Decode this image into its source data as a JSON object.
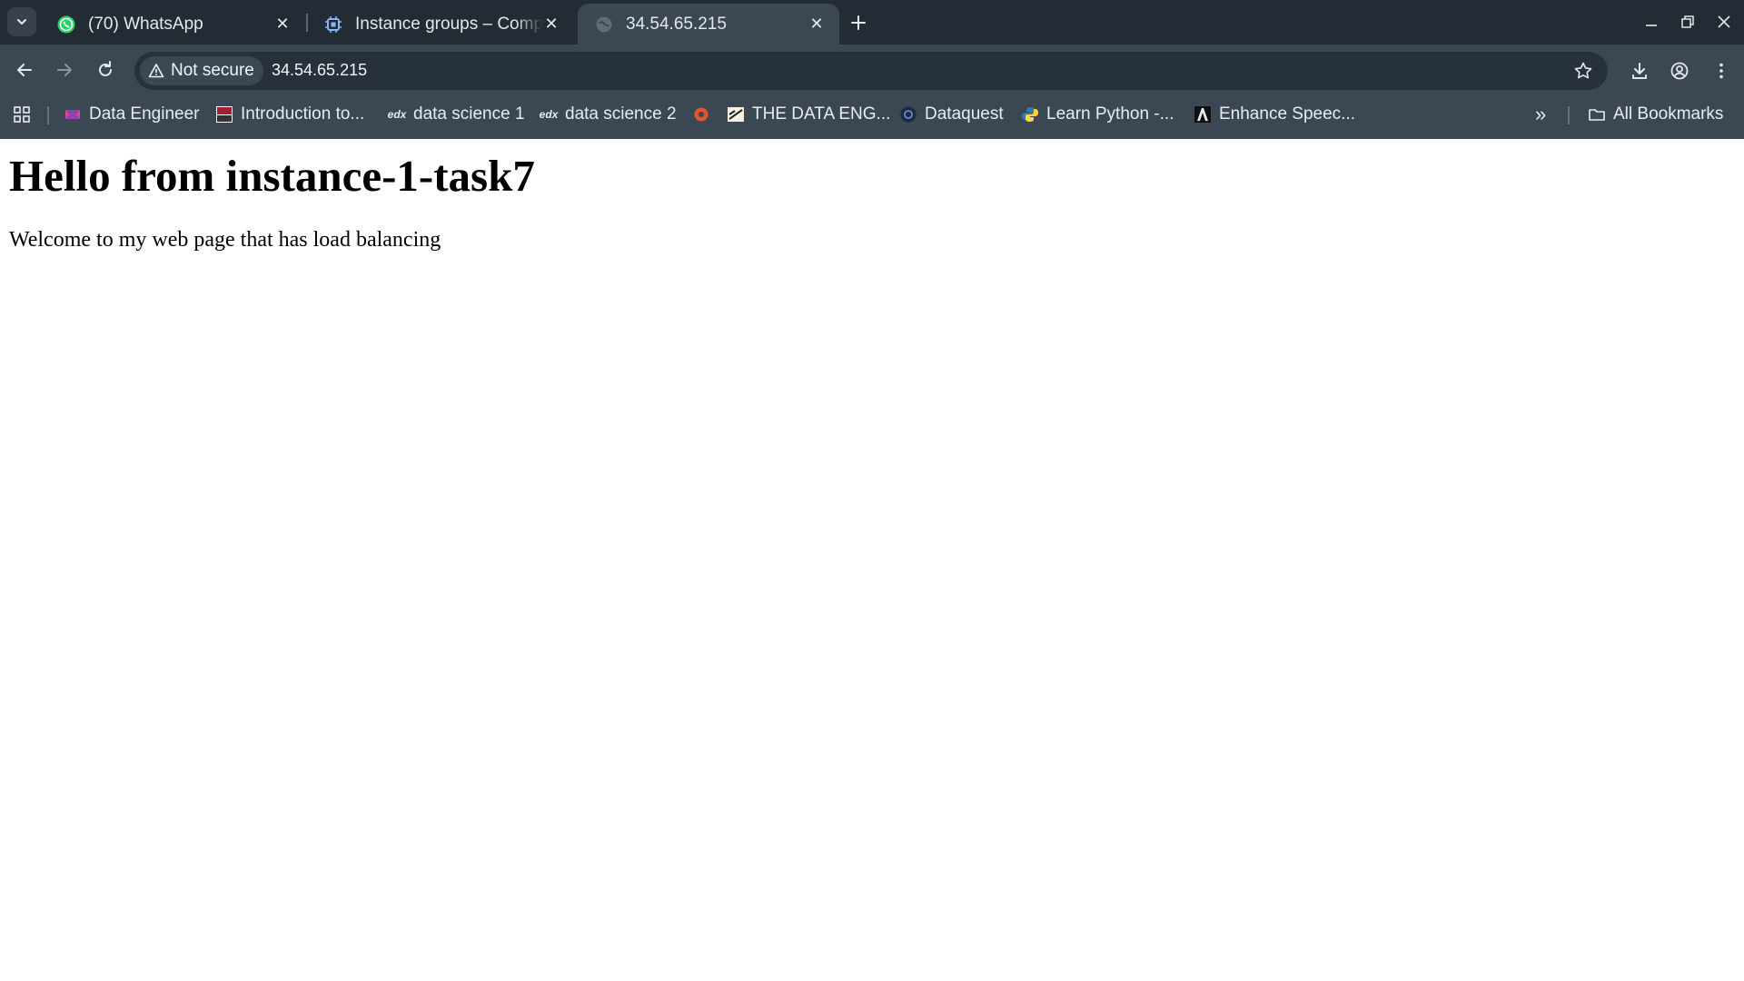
{
  "tabs": [
    {
      "title": "(70) WhatsApp",
      "icon": "whatsapp-icon",
      "active": false
    },
    {
      "title": "Instance groups – Compute Engine",
      "icon": "compute-engine-icon",
      "active": false
    },
    {
      "title": "34.54.65.215",
      "icon": "globe-icon",
      "active": true
    }
  ],
  "omnibox": {
    "security_label": "Not secure",
    "url": "34.54.65.215"
  },
  "bookmarks": {
    "items": [
      {
        "label": "Data Engineer",
        "icon": "data-engineer-icon"
      },
      {
        "label": "Introduction to...",
        "icon": "mit-ocw-icon"
      },
      {
        "label": "data science 1",
        "icon": "edx-icon"
      },
      {
        "label": "data science 2",
        "icon": "edx-icon"
      },
      {
        "label": "",
        "icon": "red-circle-icon"
      },
      {
        "label": "THE DATA ENG...",
        "icon": "data-eng-icon"
      },
      {
        "label": "Dataquest",
        "icon": "dataquest-icon"
      },
      {
        "label": "Learn Python -...",
        "icon": "python-icon"
      },
      {
        "label": "Enhance Speec...",
        "icon": "adobe-icon"
      }
    ],
    "overflow": "»",
    "all_bookmarks": "All Bookmarks"
  },
  "page": {
    "heading": "Hello from instance-1-task7",
    "body": "Welcome to my web page that has load balancing"
  },
  "colors": {
    "tabstrip": "#232b34",
    "toolbar": "#3b4854",
    "omnibox": "#27313b",
    "page_background": "#ffffff"
  }
}
